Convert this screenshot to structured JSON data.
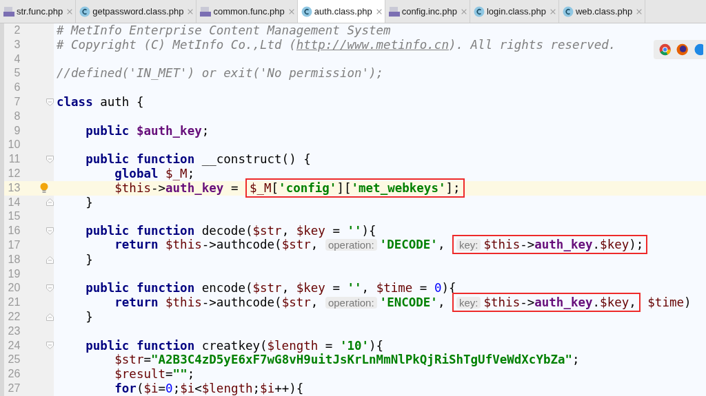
{
  "tabs": [
    {
      "label": "str.func.php",
      "kind": "php",
      "selected": false
    },
    {
      "label": "getpassword.class.php",
      "kind": "class",
      "selected": false
    },
    {
      "label": "common.func.php",
      "kind": "php",
      "selected": false
    },
    {
      "label": "auth.class.php",
      "kind": "class",
      "selected": true
    },
    {
      "label": "config.inc.php",
      "kind": "php",
      "selected": false
    },
    {
      "label": "login.class.php",
      "kind": "class",
      "selected": false
    },
    {
      "label": "web.class.php",
      "kind": "class",
      "selected": false
    }
  ],
  "lines": [
    {
      "number": "2",
      "tokens": [
        {
          "kind": "cmt",
          "t": "# MetInfo Enterprise Content Management System"
        }
      ]
    },
    {
      "number": "3",
      "tokens": [
        {
          "kind": "cmt",
          "t": "# Copyright (C) MetInfo Co.,Ltd ("
        },
        {
          "kind": "url",
          "t": "http://www.metinfo.cn"
        },
        {
          "kind": "cmt",
          "t": "). All rights reserved."
        }
      ]
    },
    {
      "number": "4"
    },
    {
      "number": "5",
      "tokens": [
        {
          "kind": "cmt",
          "t": "//defined('IN_MET') or exit('No permission');"
        }
      ]
    },
    {
      "number": "6"
    },
    {
      "number": "7",
      "fold_start": true,
      "tokens": [
        {
          "kind": "kw",
          "t": "class"
        },
        {
          "kind": "plain",
          "t": " auth {"
        }
      ]
    },
    {
      "number": "8"
    },
    {
      "number": "9",
      "tokens": [
        {
          "kind": "kw",
          "t": "    public "
        },
        {
          "kind": "prop",
          "t": "$auth_key"
        },
        {
          "kind": "plain",
          "t": ";"
        }
      ]
    },
    {
      "number": "10"
    },
    {
      "number": "11",
      "fold_start": true,
      "tokens": [
        {
          "kind": "kw",
          "t": "    public function"
        },
        {
          "kind": "plain",
          "t": " __construct() {"
        }
      ]
    },
    {
      "number": "12",
      "tokens": [
        {
          "kind": "kw",
          "t": "        global "
        },
        {
          "kind": "var",
          "t": "$_M"
        },
        {
          "kind": "plain",
          "t": ";"
        }
      ]
    },
    {
      "number": "13",
      "current": true,
      "bulb": true,
      "tokens": [
        {
          "kind": "var",
          "t": "        $this"
        },
        {
          "kind": "plain",
          "t": "->"
        },
        {
          "kind": "prop",
          "t": "auth_key"
        },
        {
          "kind": "plain",
          "t": " = "
        },
        {
          "kind": "box",
          "tokens": [
            {
              "kind": "var",
              "t": "$_M"
            },
            {
              "kind": "plain",
              "t": "["
            },
            {
              "kind": "str",
              "t": "'config'"
            },
            {
              "kind": "plain",
              "t": "]["
            },
            {
              "kind": "str",
              "t": "'met_webkeys'"
            },
            {
              "kind": "plain",
              "t": "];"
            }
          ]
        }
      ]
    },
    {
      "number": "14",
      "fold_end": true,
      "tokens": [
        {
          "kind": "plain",
          "t": "    }"
        }
      ]
    },
    {
      "number": "15"
    },
    {
      "number": "16",
      "fold_start": true,
      "tokens": [
        {
          "kind": "kw",
          "t": "    public function"
        },
        {
          "kind": "plain",
          "t": " decode("
        },
        {
          "kind": "var",
          "t": "$str"
        },
        {
          "kind": "plain",
          "t": ", "
        },
        {
          "kind": "var",
          "t": "$key"
        },
        {
          "kind": "plain",
          "t": " = "
        },
        {
          "kind": "str",
          "t": "''"
        },
        {
          "kind": "plain",
          "t": "){"
        }
      ]
    },
    {
      "number": "17",
      "tokens": [
        {
          "kind": "kw",
          "t": "        return "
        },
        {
          "kind": "var",
          "t": "$this"
        },
        {
          "kind": "plain",
          "t": "->authcode("
        },
        {
          "kind": "var",
          "t": "$str"
        },
        {
          "kind": "plain",
          "t": ", "
        },
        {
          "kind": "hint",
          "t": "operation:"
        },
        {
          "kind": "str",
          "t": "'DECODE'"
        },
        {
          "kind": "plain",
          "t": ", "
        },
        {
          "kind": "box",
          "tokens": [
            {
              "kind": "hint",
              "t": "key:"
            },
            {
              "kind": "var",
              "t": "$this"
            },
            {
              "kind": "plain",
              "t": "->"
            },
            {
              "kind": "prop",
              "t": "auth_key"
            },
            {
              "kind": "plain",
              "t": "."
            },
            {
              "kind": "var",
              "t": "$key"
            },
            {
              "kind": "plain",
              "t": ");"
            }
          ]
        }
      ]
    },
    {
      "number": "18",
      "fold_end": true,
      "tokens": [
        {
          "kind": "plain",
          "t": "    }"
        }
      ]
    },
    {
      "number": "19"
    },
    {
      "number": "20",
      "fold_start": true,
      "tokens": [
        {
          "kind": "kw",
          "t": "    public function"
        },
        {
          "kind": "plain",
          "t": " encode("
        },
        {
          "kind": "var",
          "t": "$str"
        },
        {
          "kind": "plain",
          "t": ", "
        },
        {
          "kind": "var",
          "t": "$key"
        },
        {
          "kind": "plain",
          "t": " = "
        },
        {
          "kind": "str",
          "t": "''"
        },
        {
          "kind": "plain",
          "t": ", "
        },
        {
          "kind": "var",
          "t": "$time"
        },
        {
          "kind": "plain",
          "t": " = "
        },
        {
          "kind": "num",
          "t": "0"
        },
        {
          "kind": "plain",
          "t": "){"
        }
      ]
    },
    {
      "number": "21",
      "tokens": [
        {
          "kind": "kw",
          "t": "        return "
        },
        {
          "kind": "var",
          "t": "$this"
        },
        {
          "kind": "plain",
          "t": "->authcode("
        },
        {
          "kind": "var",
          "t": "$str"
        },
        {
          "kind": "plain",
          "t": ", "
        },
        {
          "kind": "hint",
          "t": "operation:"
        },
        {
          "kind": "str",
          "t": "'ENCODE'"
        },
        {
          "kind": "plain",
          "t": ", "
        },
        {
          "kind": "box",
          "tokens": [
            {
              "kind": "hint",
              "t": "key:"
            },
            {
              "kind": "var",
              "t": "$this"
            },
            {
              "kind": "plain",
              "t": "->"
            },
            {
              "kind": "prop",
              "t": "auth_key"
            },
            {
              "kind": "plain",
              "t": "."
            },
            {
              "kind": "var",
              "t": "$key"
            },
            {
              "kind": "plain",
              "t": ","
            }
          ]
        },
        {
          "kind": "var",
          "t": " $time"
        },
        {
          "kind": "plain",
          "t": ")"
        }
      ]
    },
    {
      "number": "22",
      "fold_end": true,
      "tokens": [
        {
          "kind": "plain",
          "t": "    }"
        }
      ]
    },
    {
      "number": "23"
    },
    {
      "number": "24",
      "fold_start": true,
      "tokens": [
        {
          "kind": "kw",
          "t": "    public function"
        },
        {
          "kind": "plain",
          "t": " creatkey("
        },
        {
          "kind": "var",
          "t": "$length"
        },
        {
          "kind": "plain",
          "t": " = "
        },
        {
          "kind": "str",
          "t": "'10'"
        },
        {
          "kind": "plain",
          "t": "){"
        }
      ]
    },
    {
      "number": "25",
      "tokens": [
        {
          "kind": "var",
          "t": "        $str"
        },
        {
          "kind": "plain",
          "t": "="
        },
        {
          "kind": "str",
          "t": "\"A2B3C4zD5yE6xF7wG8vH9uitJsKrLnMmNlPkQjRiShTgUfVeWdXcYbZa\""
        },
        {
          "kind": "plain",
          "t": ";"
        }
      ]
    },
    {
      "number": "26",
      "tokens": [
        {
          "kind": "var",
          "t": "        $result"
        },
        {
          "kind": "plain",
          "t": "="
        },
        {
          "kind": "str",
          "t": "\"\""
        },
        {
          "kind": "plain",
          "t": ";"
        }
      ]
    },
    {
      "number": "27",
      "tokens": [
        {
          "kind": "kw",
          "t": "        for"
        },
        {
          "kind": "plain",
          "t": "("
        },
        {
          "kind": "var",
          "t": "$i"
        },
        {
          "kind": "plain",
          "t": "="
        },
        {
          "kind": "num",
          "t": "0"
        },
        {
          "kind": "plain",
          "t": ";"
        },
        {
          "kind": "var",
          "t": "$i"
        },
        {
          "kind": "plain",
          "t": "<"
        },
        {
          "kind": "var",
          "t": "$length"
        },
        {
          "kind": "plain",
          "t": ";"
        },
        {
          "kind": "var",
          "t": "$i"
        },
        {
          "kind": "plain",
          "t": "++){"
        }
      ]
    }
  ]
}
